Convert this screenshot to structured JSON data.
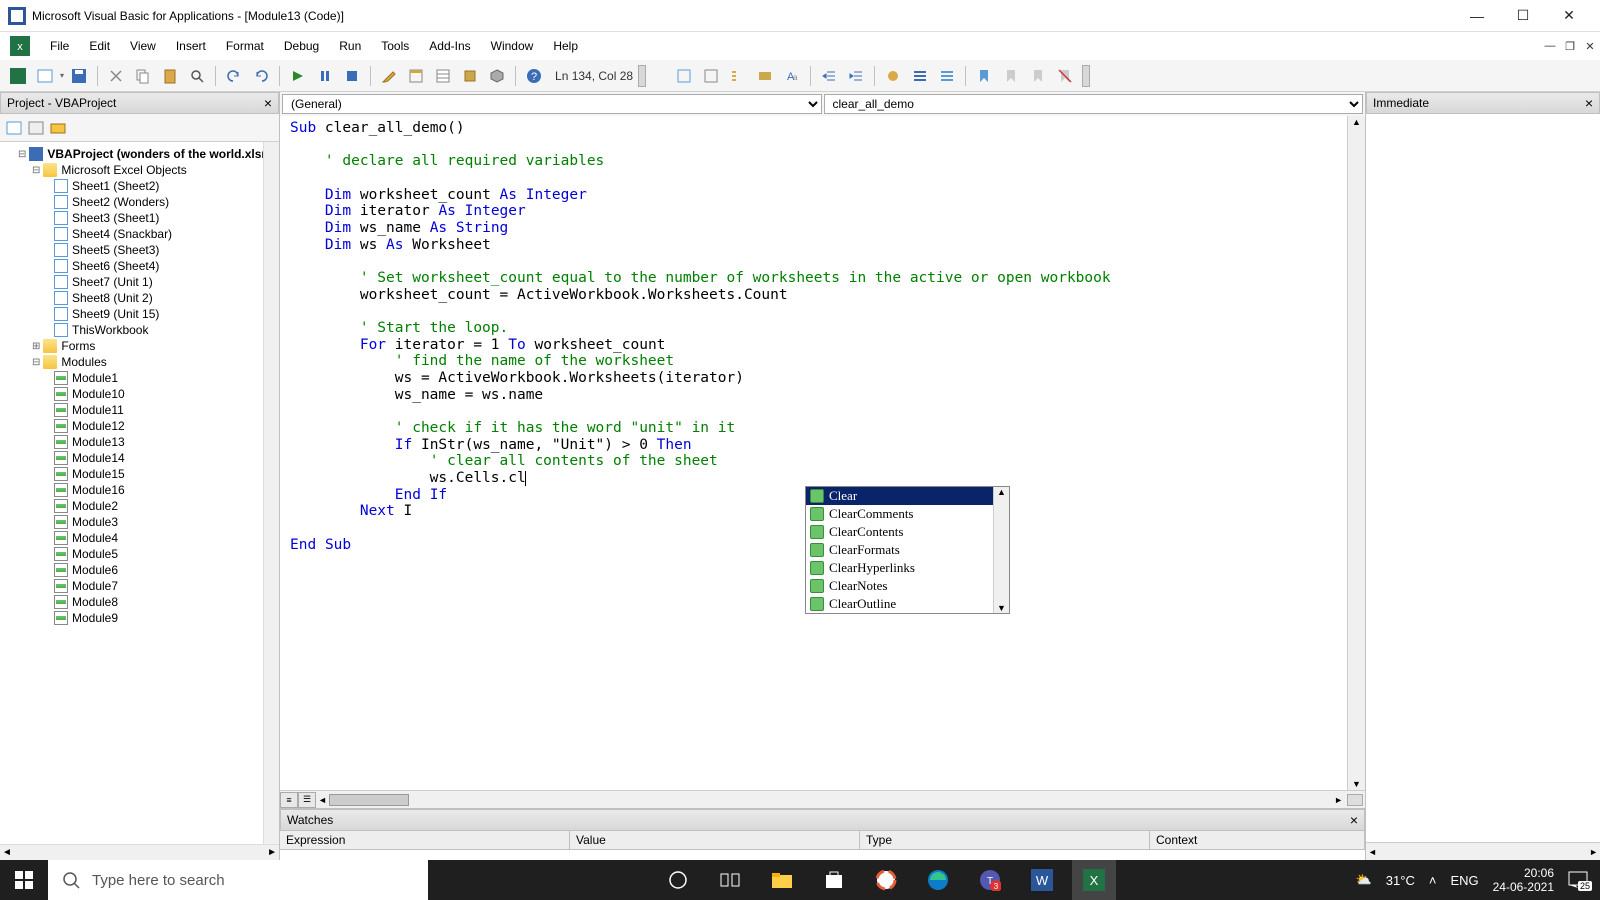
{
  "titlebar": {
    "text": "Microsoft Visual Basic for Applications - [Module13 (Code)]"
  },
  "menu": [
    "File",
    "Edit",
    "View",
    "Insert",
    "Format",
    "Debug",
    "Run",
    "Tools",
    "Add-Ins",
    "Window",
    "Help"
  ],
  "toolbar_status": "Ln 134, Col 28",
  "project_panel": {
    "title": "Project - VBAProject",
    "root": "VBAProject (wonders of the world.xlsm)",
    "excel_folder": "Microsoft Excel Objects",
    "sheets": [
      "Sheet1 (Sheet2)",
      "Sheet2 (Wonders)",
      "Sheet3 (Sheet1)",
      "Sheet4 (Snackbar)",
      "Sheet5 (Sheet3)",
      "Sheet6 (Sheet4)",
      "Sheet7 (Unit 1)",
      "Sheet8 (Unit 2)",
      "Sheet9 (Unit 15)",
      "ThisWorkbook"
    ],
    "forms_folder": "Forms",
    "modules_folder": "Modules",
    "modules": [
      "Module1",
      "Module10",
      "Module11",
      "Module12",
      "Module13",
      "Module14",
      "Module15",
      "Module16",
      "Module2",
      "Module3",
      "Module4",
      "Module5",
      "Module6",
      "Module7",
      "Module8",
      "Module9"
    ]
  },
  "code": {
    "scope_left": "(General)",
    "scope_right": "clear_all_demo",
    "lines": [
      {
        "t": "Sub clear_all_demo()",
        "k": [
          "Sub"
        ]
      },
      {
        "t": ""
      },
      {
        "t": "    ' declare all required variables",
        "c": true
      },
      {
        "t": ""
      },
      {
        "t": "    Dim worksheet_count As Integer",
        "k": [
          "Dim",
          "As",
          "Integer"
        ]
      },
      {
        "t": "    Dim iterator As Integer",
        "k": [
          "Dim",
          "As",
          "Integer"
        ]
      },
      {
        "t": "    Dim ws_name As String",
        "k": [
          "Dim",
          "As",
          "String"
        ]
      },
      {
        "t": "    Dim ws As Worksheet",
        "k": [
          "Dim",
          "As"
        ]
      },
      {
        "t": ""
      },
      {
        "t": "        ' Set worksheet_count equal to the number of worksheets in the active or open workbook",
        "c": true
      },
      {
        "t": "        worksheet_count = ActiveWorkbook.Worksheets.Count"
      },
      {
        "t": ""
      },
      {
        "t": "        ' Start the loop.",
        "c": true
      },
      {
        "t": "        For iterator = 1 To worksheet_count",
        "k": [
          "For",
          "To"
        ]
      },
      {
        "t": "            ' find the name of the worksheet",
        "c": true
      },
      {
        "t": "            ws = ActiveWorkbook.Worksheets(iterator)"
      },
      {
        "t": "            ws_name = ws.name"
      },
      {
        "t": ""
      },
      {
        "t": "            ' check if it has the word \"unit\" in it",
        "c": true
      },
      {
        "t": "            If InStr(ws_name, \"Unit\") > 0 Then",
        "k": [
          "If",
          "Then"
        ]
      },
      {
        "t": "                ' clear all contents of the sheet",
        "c": true
      },
      {
        "t": "                ws.Cells.cl",
        "caret": true
      },
      {
        "t": "            End If",
        "k": [
          "End",
          "If"
        ]
      },
      {
        "t": "        Next I",
        "k": [
          "Next"
        ]
      },
      {
        "t": ""
      },
      {
        "t": "End Sub",
        "k": [
          "End",
          "Sub"
        ]
      }
    ],
    "autocomplete": [
      "Clear",
      "ClearComments",
      "ClearContents",
      "ClearFormats",
      "ClearHyperlinks",
      "ClearNotes",
      "ClearOutline"
    ],
    "autocomplete_selected": 0
  },
  "immediate_title": "Immediate",
  "watches": {
    "title": "Watches",
    "columns": [
      "Expression",
      "Value",
      "Type",
      "Context"
    ]
  },
  "taskbar": {
    "search_placeholder": "Type here to search",
    "temp": "31°C",
    "lang": "ENG",
    "time": "20:06",
    "date": "24-06-2021",
    "notif": "25"
  }
}
